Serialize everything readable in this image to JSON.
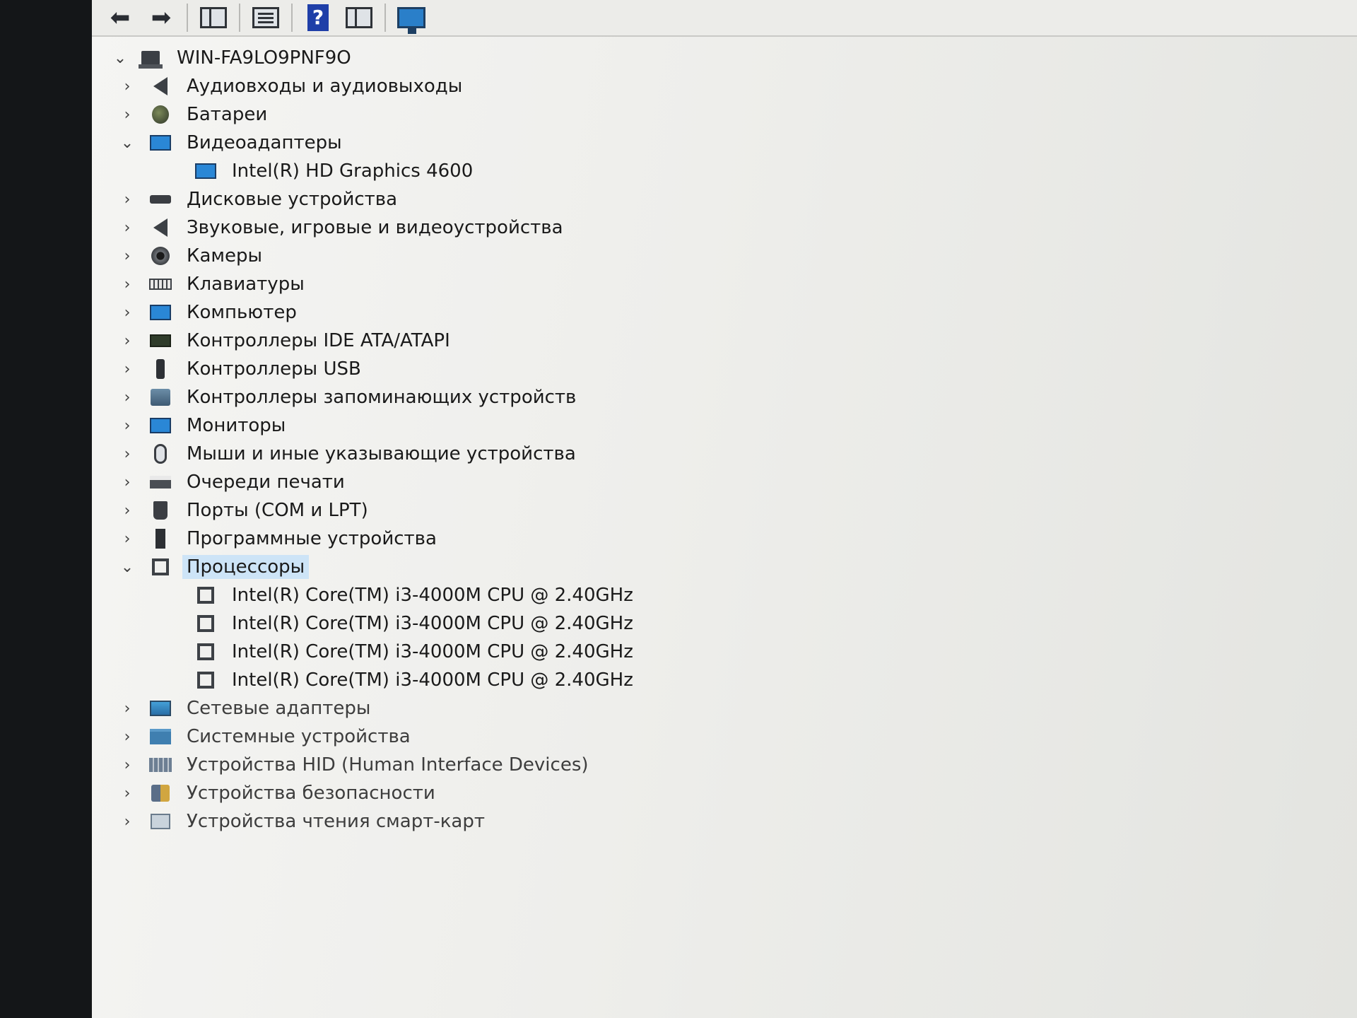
{
  "toolbar": {
    "back_icon": "arrow-left-icon",
    "forward_icon": "arrow-right-icon",
    "help_glyph": "?"
  },
  "tree": {
    "root": "WIN-FA9LO9PNF9O",
    "categories": [
      {
        "label": "Аудиовходы и аудиовыходы",
        "icon": "speaker-icon",
        "expanded": false
      },
      {
        "label": "Батареи",
        "icon": "battery-icon",
        "expanded": false
      },
      {
        "label": "Видеоадаптеры",
        "icon": "display-adapter-icon",
        "expanded": true,
        "children": [
          "Intel(R) HD Graphics 4600"
        ]
      },
      {
        "label": "Дисковые устройства",
        "icon": "disk-drive-icon",
        "expanded": false
      },
      {
        "label": "Звуковые, игровые и видеоустройства",
        "icon": "sound-icon",
        "expanded": false
      },
      {
        "label": "Камеры",
        "icon": "camera-icon",
        "expanded": false
      },
      {
        "label": "Клавиатуры",
        "icon": "keyboard-icon",
        "expanded": false
      },
      {
        "label": "Компьютер",
        "icon": "computer-icon",
        "expanded": false
      },
      {
        "label": "Контроллеры IDE ATA/ATAPI",
        "icon": "ide-controller-icon",
        "expanded": false
      },
      {
        "label": "Контроллеры USB",
        "icon": "usb-icon",
        "expanded": false
      },
      {
        "label": "Контроллеры запоминающих устройств",
        "icon": "storage-controller-icon",
        "expanded": false
      },
      {
        "label": "Мониторы",
        "icon": "monitor-icon",
        "expanded": false
      },
      {
        "label": "Мыши и иные указывающие устройства",
        "icon": "mouse-icon",
        "expanded": false
      },
      {
        "label": "Очереди печати",
        "icon": "printer-icon",
        "expanded": false
      },
      {
        "label": "Порты (COM и LPT)",
        "icon": "port-icon",
        "expanded": false
      },
      {
        "label": "Программные устройства",
        "icon": "software-device-icon",
        "expanded": false
      },
      {
        "label": "Процессоры",
        "icon": "processor-icon",
        "expanded": true,
        "selected": true,
        "children": [
          "Intel(R) Core(TM) i3-4000M CPU @ 2.40GHz",
          "Intel(R) Core(TM) i3-4000M CPU @ 2.40GHz",
          "Intel(R) Core(TM) i3-4000M CPU @ 2.40GHz",
          "Intel(R) Core(TM) i3-4000M CPU @ 2.40GHz"
        ]
      },
      {
        "label": "Сетевые адаптеры",
        "icon": "network-adapter-icon",
        "expanded": false
      },
      {
        "label": "Системные устройства",
        "icon": "system-devices-icon",
        "expanded": false
      },
      {
        "label": "Устройства HID (Human Interface Devices)",
        "icon": "hid-icon",
        "expanded": false
      },
      {
        "label": "Устройства безопасности",
        "icon": "security-device-icon",
        "expanded": false
      },
      {
        "label": "Устройства чтения смарт-карт",
        "icon": "smart-card-reader-icon",
        "expanded": false
      }
    ]
  },
  "colors": {
    "selection": "#cde4f7",
    "background": "#eeeeeb"
  }
}
